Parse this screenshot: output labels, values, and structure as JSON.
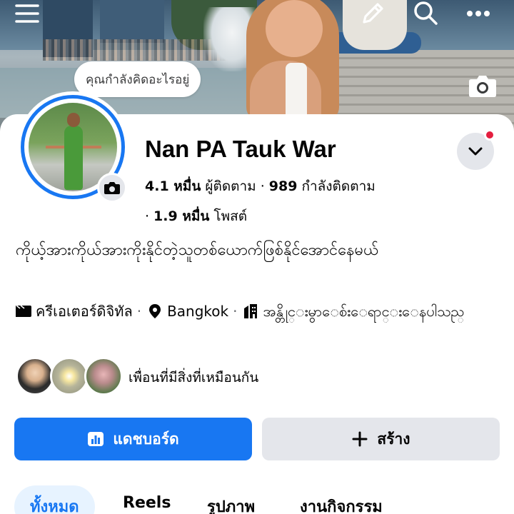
{
  "cover": {
    "thought_prompt": "คุณกำลังคิดอะไรอยู่"
  },
  "topbar": {
    "icons": [
      "menu-icon",
      "edit-icon",
      "search-icon",
      "more-icon"
    ]
  },
  "profile": {
    "name": "Nan PA Tauk War",
    "followers_count": "4.1 หมื่น",
    "followers_label": "ผู้ติดตาม",
    "following_count": "989",
    "following_label": "กำลังติดตาม",
    "posts_count": "1.9 หมื่น",
    "posts_label": "โพสต์",
    "bio": "ကိုယ့်အားကိုယ်အားကိုးနိုင်တဲ့သူတစ်ယောက်ဖြစ်နိုင်အောင်နေမယ်",
    "info": {
      "category": "ครีเอเตอร์ดิจิทัล",
      "location": "Bangkok",
      "workplace": "အန္တိုင္းမွာေစ်းေရာင္းေနပါသည္"
    },
    "mutual_label": "เพื่อนที่มีสิ่งที่เหมือนกัน"
  },
  "buttons": {
    "dashboard": "แดชบอร์ด",
    "create": "สร้าง"
  },
  "tabs": {
    "all": "ทั้งหมด",
    "reels": "Reels",
    "photos": "รูปภาพ",
    "events": "งานกิจกรรม"
  },
  "colors": {
    "accent": "#1877f2",
    "notification": "#e41e3f",
    "secondary_button": "#e4e6eb"
  }
}
